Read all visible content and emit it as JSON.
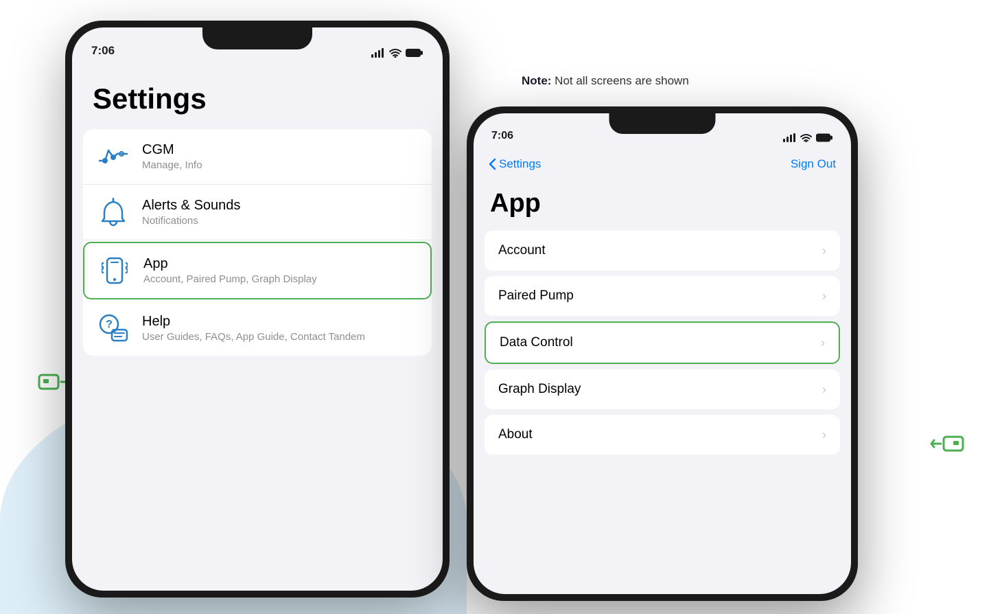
{
  "page": {
    "background": "#ffffff",
    "note": {
      "label": "Note:",
      "text": " Not all screens are shown"
    }
  },
  "phone1": {
    "status": {
      "time": "7:06"
    },
    "title": "Settings",
    "items": [
      {
        "id": "cgm",
        "icon": "cgm-icon",
        "title": "CGM",
        "subtitle": "Manage, Info",
        "active": false
      },
      {
        "id": "alerts",
        "icon": "bell-icon",
        "title": "Alerts & Sounds",
        "subtitle": "Notifications",
        "active": false
      },
      {
        "id": "app",
        "icon": "phone-vibrate-icon",
        "title": "App",
        "subtitle": "Account, Paired Pump, Graph Display",
        "active": true
      },
      {
        "id": "help",
        "icon": "help-icon",
        "title": "Help",
        "subtitle": "User Guides, FAQs, App Guide, Contact Tandem",
        "active": false
      }
    ]
  },
  "phone2": {
    "status": {
      "time": "7:06"
    },
    "navbar": {
      "back_label": "Settings",
      "signout_label": "Sign Out"
    },
    "title": "App",
    "items": [
      {
        "id": "account",
        "label": "Account",
        "active": false
      },
      {
        "id": "paired-pump",
        "label": "Paired Pump",
        "active": false
      },
      {
        "id": "data-control",
        "label": "Data Control",
        "active": true
      },
      {
        "id": "graph-display",
        "label": "Graph Display",
        "active": false
      },
      {
        "id": "about",
        "label": "About",
        "active": false
      }
    ]
  }
}
